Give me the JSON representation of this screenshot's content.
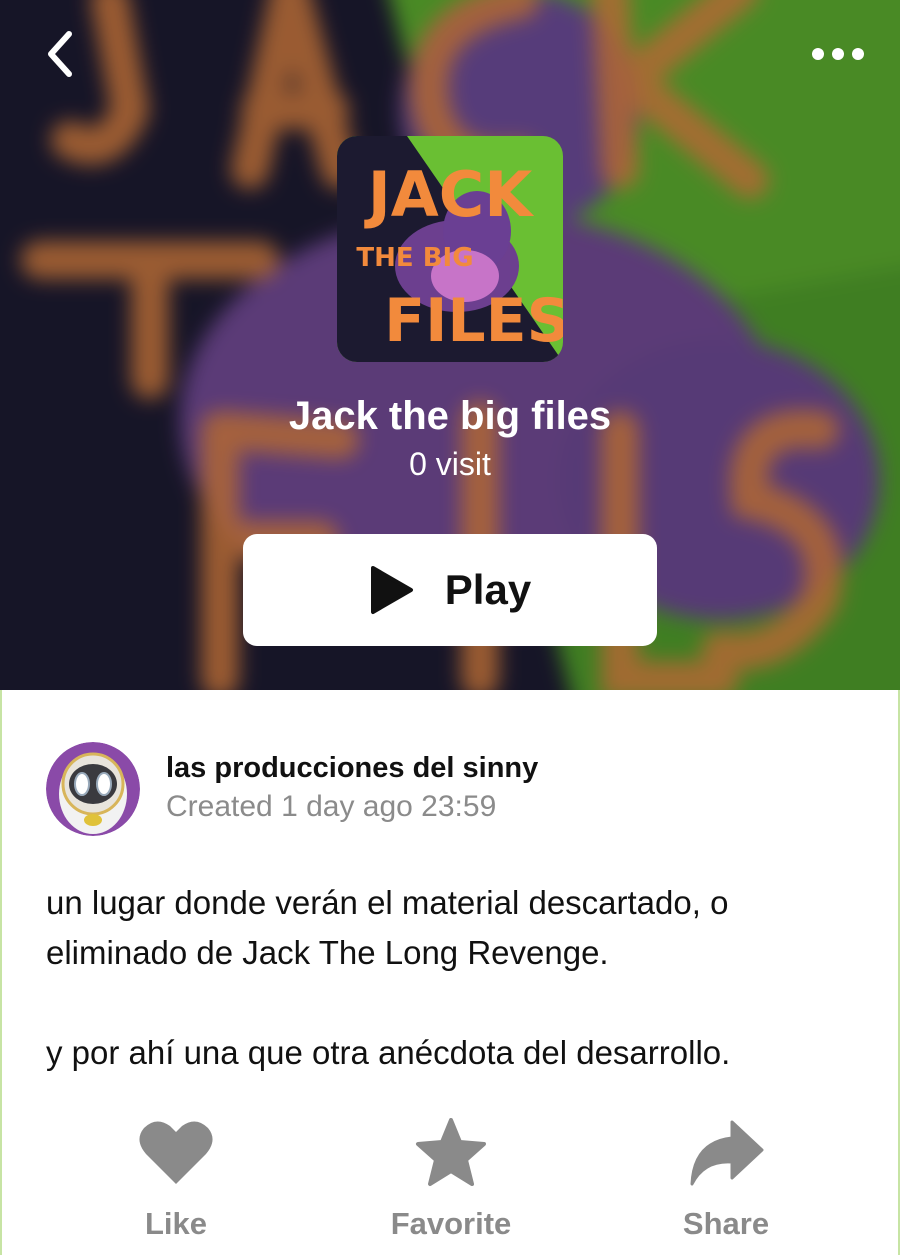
{
  "header": {
    "back_icon": "chevron-left-icon",
    "more_icon": "more-horizontal-icon"
  },
  "game": {
    "title": "Jack the big files",
    "visits": "0 visit",
    "thumbnail_text": {
      "line1": "JACK",
      "line2": "THE BIG",
      "line3": "FILES"
    },
    "play_label": "Play"
  },
  "creator": {
    "name": "las producciones del sinny",
    "created": "Created 1 day ago 23:59"
  },
  "description": {
    "line1": "un lugar donde verán el material descartado, o eliminado de Jack The Long Revenge.",
    "line2": "y por ahí una que otra anécdota del desarrollo."
  },
  "actions": {
    "like": "Like",
    "favorite": "Favorite",
    "share": "Share"
  },
  "colors": {
    "green": "#5fb52e",
    "dark_navy": "#1b1830",
    "purple": "#7a4a9c",
    "orange": "#e8843a",
    "action_gray": "#8a8a8a"
  }
}
